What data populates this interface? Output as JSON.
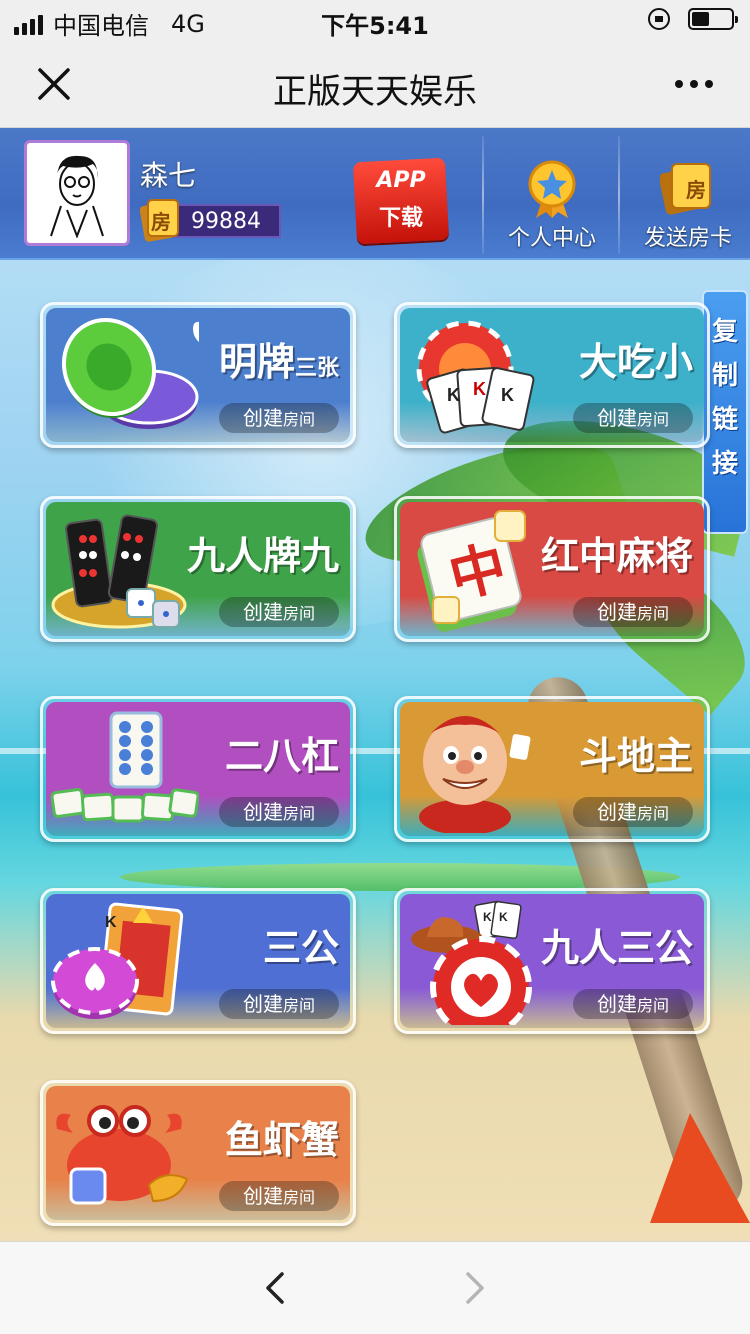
{
  "status_bar": {
    "carrier": "中国电信",
    "network": "4G",
    "time": "下午5:41",
    "battery_level": 0.45
  },
  "nav": {
    "title": "正版天天娱乐"
  },
  "header": {
    "player_name": "森七",
    "room_card_glyph": "房",
    "room_cards": "99884",
    "app_download_line1": "APP",
    "app_download_line2": "下载",
    "personal_center": "个人中心",
    "send_card": "发送房卡",
    "send_card_glyph": "房"
  },
  "copy_link": {
    "label": "复制链接"
  },
  "games": [
    {
      "name": "明牌",
      "suffix": "三张",
      "button": "创建",
      "button_suffix": "房间",
      "color": "#4d7fcf"
    },
    {
      "name": "大吃小",
      "suffix": "",
      "button": "创建",
      "button_suffix": "房间",
      "color": "#3cb1c9"
    },
    {
      "name": "九人牌九",
      "suffix": "",
      "button": "创建",
      "button_suffix": "房间",
      "color": "#3fa34a"
    },
    {
      "name": "红中麻将",
      "suffix": "",
      "button": "创建",
      "button_suffix": "房间",
      "color": "#d94a44"
    },
    {
      "name": "二八杠",
      "suffix": "",
      "button": "创建",
      "button_suffix": "房间",
      "color": "#b24fc0"
    },
    {
      "name": "斗地主",
      "suffix": "",
      "button": "创建",
      "button_suffix": "房间",
      "color": "#d99a36"
    },
    {
      "name": "三公",
      "suffix": "",
      "button": "创建",
      "button_suffix": "房间",
      "color": "#4f6fd4"
    },
    {
      "name": "九人三公",
      "suffix": "",
      "button": "创建",
      "button_suffix": "房间",
      "color": "#8a5ad6"
    },
    {
      "name": "鱼虾蟹",
      "suffix": "",
      "button": "创建",
      "button_suffix": "房间",
      "color": "#e8824a"
    }
  ]
}
